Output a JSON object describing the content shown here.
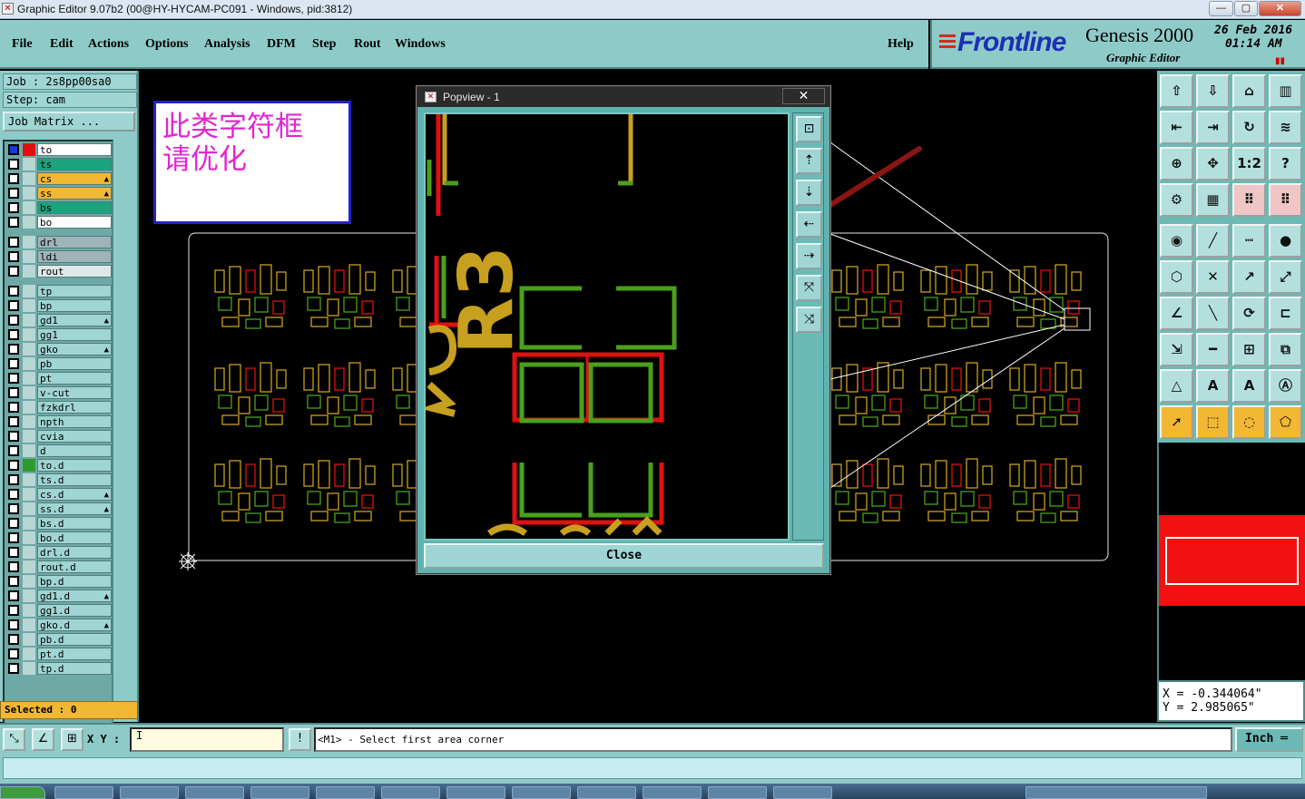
{
  "window": {
    "title": "Graphic Editor 9.07b2 (00@HY-HYCAM-PC091 - Windows, pid:3812)",
    "minimize": "—",
    "maximize": "▢",
    "close": "✕"
  },
  "menu": [
    "File",
    "Edit",
    "Actions",
    "Options",
    "Analysis",
    "DFM",
    "Step",
    "Rout",
    "Windows"
  ],
  "help": "Help",
  "brand": {
    "logo": "Frontline",
    "product": "Genesis 2000",
    "module": "Graphic Editor",
    "date": "26 Feb 2016",
    "time": "01:14 AM",
    "pause_icon": "pause-icon"
  },
  "job": {
    "job_line": "Job : 2s8pp00sa0",
    "step_line": "Step: cam",
    "matrix_button": "Job Matrix ..."
  },
  "layers": [
    {
      "name": "to",
      "color": "#ffffff",
      "state": "active",
      "swatch": "#e01010"
    },
    {
      "name": "ts",
      "color": "#1aa37c",
      "state": "",
      "swatch": ""
    },
    {
      "name": "cs",
      "color": "#f2b733",
      "state": "",
      "swatch": "",
      "mark": "▲"
    },
    {
      "name": "ss",
      "color": "#f2b733",
      "state": "",
      "swatch": "",
      "mark": "▲"
    },
    {
      "name": "bs",
      "color": "#1aa37c",
      "state": "",
      "swatch": ""
    },
    {
      "name": "bo",
      "color": "#ffffff",
      "state": "",
      "swatch": ""
    },
    {
      "name": "drl",
      "color": "#9fb3b8",
      "state": "",
      "swatch": ""
    },
    {
      "name": "ldi",
      "color": "#9fb3b8",
      "state": "",
      "swatch": ""
    },
    {
      "name": "rout",
      "color": "#dfe8e8",
      "state": "",
      "swatch": ""
    },
    {
      "name": "tp",
      "color": "#9fd5d2",
      "state": "",
      "swatch": ""
    },
    {
      "name": "bp",
      "color": "#9fd5d2",
      "state": "",
      "swatch": ""
    },
    {
      "name": "gd1",
      "color": "#9fd5d2",
      "state": "",
      "swatch": "",
      "mark": "▲"
    },
    {
      "name": "gg1",
      "color": "#9fd5d2",
      "state": "",
      "swatch": ""
    },
    {
      "name": "gko",
      "color": "#9fd5d2",
      "state": "",
      "swatch": "",
      "mark": "▲"
    },
    {
      "name": "pb",
      "color": "#9fd5d2",
      "state": "",
      "swatch": ""
    },
    {
      "name": "pt",
      "color": "#9fd5d2",
      "state": "",
      "swatch": ""
    },
    {
      "name": "v-cut",
      "color": "#9fd5d2",
      "state": "",
      "swatch": ""
    },
    {
      "name": "fzkdrl",
      "color": "#9fd5d2",
      "state": "",
      "swatch": ""
    },
    {
      "name": "npth",
      "color": "#9fd5d2",
      "state": "",
      "swatch": ""
    },
    {
      "name": "cvia",
      "color": "#9fd5d2",
      "state": "",
      "swatch": ""
    },
    {
      "name": "d",
      "color": "#9fd5d2",
      "state": "",
      "swatch": ""
    },
    {
      "name": "to.d",
      "color": "#9fd5d2",
      "state": "",
      "swatch": "#2e9a2e"
    },
    {
      "name": "ts.d",
      "color": "#9fd5d2",
      "state": "",
      "swatch": ""
    },
    {
      "name": "cs.d",
      "color": "#9fd5d2",
      "state": "",
      "swatch": "",
      "mark": "▲"
    },
    {
      "name": "ss.d",
      "color": "#9fd5d2",
      "state": "",
      "swatch": "",
      "mark": "▲"
    },
    {
      "name": "bs.d",
      "color": "#9fd5d2",
      "state": "",
      "swatch": ""
    },
    {
      "name": "bo.d",
      "color": "#9fd5d2",
      "state": "",
      "swatch": ""
    },
    {
      "name": "drl.d",
      "color": "#9fd5d2",
      "state": "",
      "swatch": ""
    },
    {
      "name": "rout.d",
      "color": "#9fd5d2",
      "state": "",
      "swatch": ""
    },
    {
      "name": "bp.d",
      "color": "#9fd5d2",
      "state": "",
      "swatch": ""
    },
    {
      "name": "gd1.d",
      "color": "#9fd5d2",
      "state": "",
      "swatch": "",
      "mark": "▲"
    },
    {
      "name": "gg1.d",
      "color": "#9fd5d2",
      "state": "",
      "swatch": ""
    },
    {
      "name": "gko.d",
      "color": "#9fd5d2",
      "state": "",
      "swatch": "",
      "mark": "▲"
    },
    {
      "name": "pb.d",
      "color": "#9fd5d2",
      "state": "",
      "swatch": ""
    },
    {
      "name": "pt.d",
      "color": "#9fd5d2",
      "state": "",
      "swatch": ""
    },
    {
      "name": "tp.d",
      "color": "#9fd5d2",
      "state": "",
      "swatch": ""
    }
  ],
  "selected": "Selected : 0",
  "annotation": {
    "line1": "此类字符框",
    "line2": "请优化"
  },
  "popview": {
    "title": "Popview - 1",
    "close_x": "✕",
    "close_button": "Close",
    "silk_text": "R3"
  },
  "coords": {
    "x": "X = -0.344064\"",
    "y": "Y = 2.985065\""
  },
  "status": {
    "xy_label": "X Y :",
    "xy_value": "I",
    "message": "<M1> - Select first area corner",
    "unit": "Inch ═"
  },
  "colors": {
    "panel": "#8ecbc8",
    "silk": "#c8a020",
    "mask": "#e01010",
    "copper": "#4aa01c",
    "highlight": "#f2b733"
  }
}
